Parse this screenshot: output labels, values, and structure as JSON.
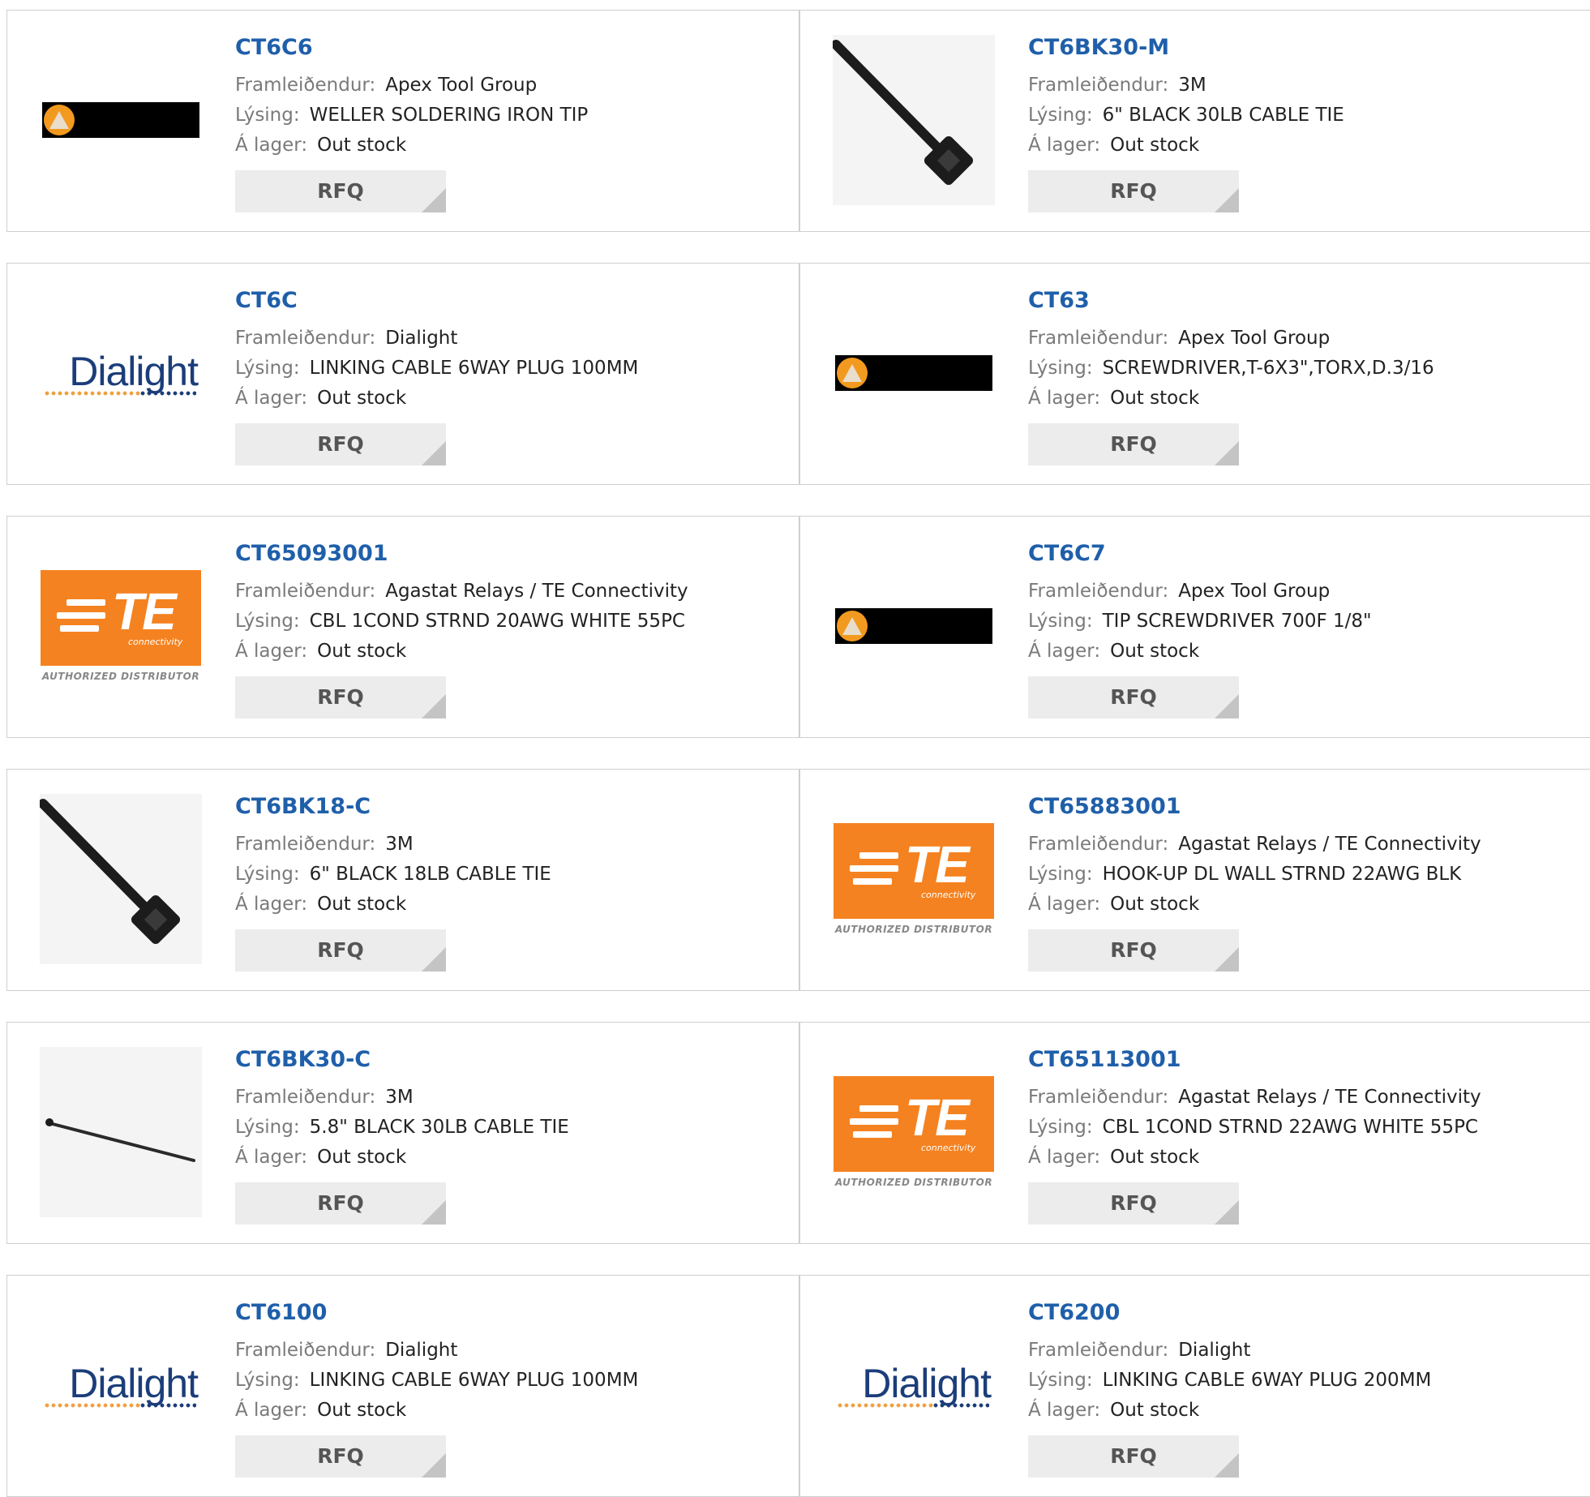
{
  "labels": {
    "manufacturer": "Framleiðendur:",
    "description": "Lýsing:",
    "stock": "Á lager:",
    "rfq": "RFQ"
  },
  "products": [
    {
      "pn": "CT6C6",
      "manufacturer": "Apex Tool Group",
      "description": "WELLER SOLDERING IRON TIP",
      "stock": "Out stock",
      "logo": "apex-logo"
    },
    {
      "pn": "CT6BK30-M",
      "manufacturer": "3M",
      "description": "6\" BLACK 30LB CABLE TIE",
      "stock": "Out stock",
      "logo": "cable-tie-photo"
    },
    {
      "pn": "CT6C",
      "manufacturer": "Dialight",
      "description": "LINKING CABLE 6WAY PLUG 100MM",
      "stock": "Out stock",
      "logo": "dialight-logo"
    },
    {
      "pn": "CT63",
      "manufacturer": "Apex Tool Group",
      "description": "SCREWDRIVER,T-6X3\",TORX,D.3/16",
      "stock": "Out stock",
      "logo": "apex-logo"
    },
    {
      "pn": "CT65093001",
      "manufacturer": "Agastat Relays / TE Connectivity",
      "description": "CBL 1COND STRND 20AWG WHITE 55PC",
      "stock": "Out stock",
      "logo": "te-logo"
    },
    {
      "pn": "CT6C7",
      "manufacturer": "Apex Tool Group",
      "description": "TIP SCREWDRIVER 700F 1/8\"",
      "stock": "Out stock",
      "logo": "apex-logo"
    },
    {
      "pn": "CT6BK18-C",
      "manufacturer": "3M",
      "description": "6\" BLACK 18LB CABLE TIE",
      "stock": "Out stock",
      "logo": "cable-tie-photo"
    },
    {
      "pn": "CT65883001",
      "manufacturer": "Agastat Relays / TE Connectivity",
      "description": "HOOK-UP DL WALL STRND 22AWG BLK",
      "stock": "Out stock",
      "logo": "te-logo"
    },
    {
      "pn": "CT6BK30-C",
      "manufacturer": "3M",
      "description": "5.8\" BLACK 30LB CABLE TIE",
      "stock": "Out stock",
      "logo": "thin-cable-tie-photo"
    },
    {
      "pn": "CT65113001",
      "manufacturer": "Agastat Relays / TE Connectivity",
      "description": "CBL 1COND STRND 22AWG WHITE 55PC",
      "stock": "Out stock",
      "logo": "te-logo"
    },
    {
      "pn": "CT6100",
      "manufacturer": "Dialight",
      "description": "LINKING CABLE 6WAY PLUG 100MM",
      "stock": "Out stock",
      "logo": "dialight-logo"
    },
    {
      "pn": "CT6200",
      "manufacturer": "Dialight",
      "description": "LINKING CABLE 6WAY PLUG 200MM",
      "stock": "Out stock",
      "logo": "dialight-logo"
    }
  ],
  "logos": {
    "dialight_word": "Dialight",
    "te_letters": "TE",
    "te_sub": "connectivity",
    "te_authorized": "AUTHORIZED DISTRIBUTOR"
  },
  "colors": {
    "link": "#1f5faa",
    "te_orange": "#f58220",
    "apex_orange": "#f29a1f"
  }
}
